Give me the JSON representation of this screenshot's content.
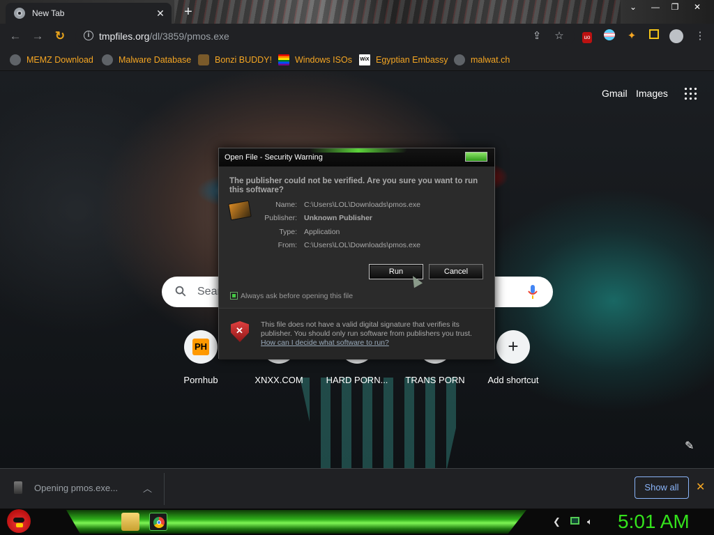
{
  "browser": {
    "tab_title": "New Tab",
    "url_host": "tmpfiles.org",
    "url_path": "/dl/3859/pmos.exe"
  },
  "bookmarks": [
    {
      "label": "MEMZ Download",
      "icon": "globe-icon"
    },
    {
      "label": "Malware Database",
      "icon": "globe-icon"
    },
    {
      "label": "Bonzi BUDDY!",
      "icon": "bonzi-icon"
    },
    {
      "label": "Windows ISOs",
      "icon": "windows-flag-icon"
    },
    {
      "label": "Egyptian Embassy",
      "icon": "wix-icon"
    },
    {
      "label": "malwat.ch",
      "icon": "globe-icon"
    }
  ],
  "newtab": {
    "gmail": "Gmail",
    "images": "Images",
    "search_placeholder": "Sear",
    "shortcuts": [
      {
        "label": "Pornhub",
        "badge": "PH"
      },
      {
        "label": "XNXX.COM"
      },
      {
        "label": "HARD PORN..."
      },
      {
        "label": "TRANS PORN"
      },
      {
        "label": "Add shortcut"
      }
    ]
  },
  "dialog": {
    "title": "Open File - Security Warning",
    "question": "The publisher could not be verified.  Are you sure you want to run this software?",
    "fields": [
      {
        "key": "Name:",
        "value": "C:\\Users\\LOL\\Downloads\\pmos.exe"
      },
      {
        "key": "Publisher:",
        "value": "Unknown Publisher"
      },
      {
        "key": "Type:",
        "value": "Application"
      },
      {
        "key": "From:",
        "value": "C:\\Users\\LOL\\Downloads\\pmos.exe"
      }
    ],
    "run": "Run",
    "cancel": "Cancel",
    "checkbox": "Always ask before opening this file",
    "warning": "This file does not have a valid digital signature that verifies its publisher.  You should only run software from publishers you trust.",
    "link": "How can I decide what software to run?"
  },
  "download": {
    "status": "Opening pmos.exe...",
    "show_all": "Show all"
  },
  "taskbar": {
    "clock": "5:01 AM"
  },
  "colors": {
    "bookmark_text": "#f5a623",
    "clock_green": "#34e21c",
    "show_all_blue": "#8ab4f8"
  }
}
